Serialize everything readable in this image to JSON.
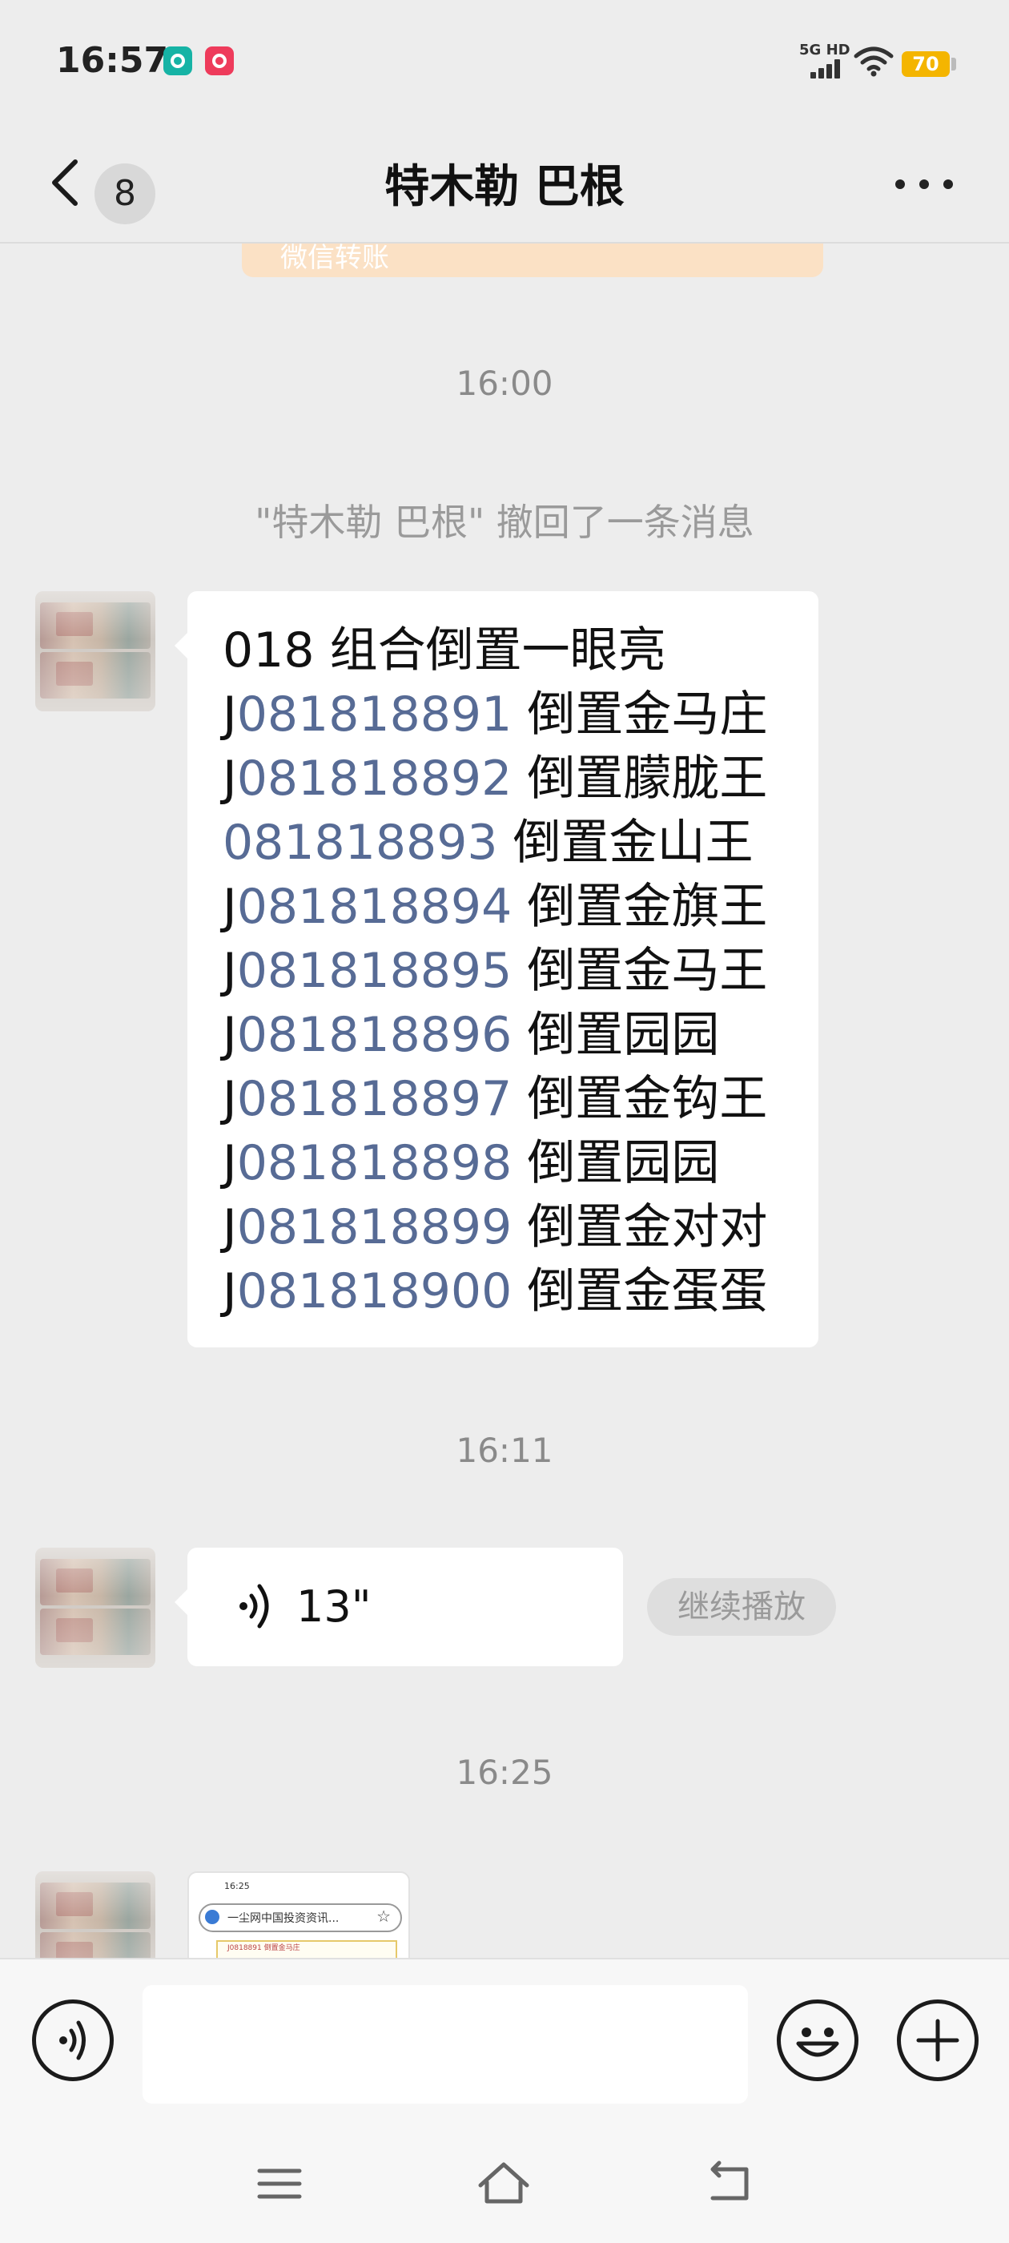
{
  "status_bar": {
    "time": "16:57",
    "network": "5G HD",
    "battery": "70"
  },
  "header": {
    "unread_count": "8",
    "title": "特木勒 巴根"
  },
  "chat": {
    "transfer_card_text": "微信转账",
    "timestamps": [
      "16:00",
      "16:11",
      "16:25"
    ],
    "recall_notice": "\"特木勒 巴根\" 撤回了一条消息",
    "text_message": {
      "heading": "018 组合倒置一眼亮",
      "lines": [
        {
          "prefix": "J",
          "number": "081818891",
          "suffix": " 倒置金马庄"
        },
        {
          "prefix": "J",
          "number": "081818892",
          "suffix": " 倒置朦胧王"
        },
        {
          "prefix": "",
          "number": "081818893",
          "suffix": " 倒置金山王"
        },
        {
          "prefix": "J",
          "number": "081818894",
          "suffix": " 倒置金旗王"
        },
        {
          "prefix": "J",
          "number": "081818895",
          "suffix": " 倒置金马王"
        },
        {
          "prefix": "J",
          "number": "081818896",
          "suffix": " 倒置园园"
        },
        {
          "prefix": "J",
          "number": "081818897",
          "suffix": " 倒置金钩王"
        },
        {
          "prefix": "J",
          "number": "081818898",
          "suffix": " 倒置园园"
        },
        {
          "prefix": "J",
          "number": "081818899",
          "suffix": " 倒置金对对"
        },
        {
          "prefix": "J",
          "number": "081818900",
          "suffix": " 倒置金蛋蛋"
        }
      ]
    },
    "voice_message": {
      "duration": "13\"",
      "continue_label": "继续播放"
    },
    "image_message": {
      "status_time": "16:25",
      "url_text": "一尘网中国投资资讯...",
      "doc_text": "J0818891 倒置金马庄"
    }
  },
  "colors": {
    "background": "#ededed",
    "bubble": "#ffffff",
    "link_number": "#576b95",
    "muted_text": "#8a8a8a"
  }
}
